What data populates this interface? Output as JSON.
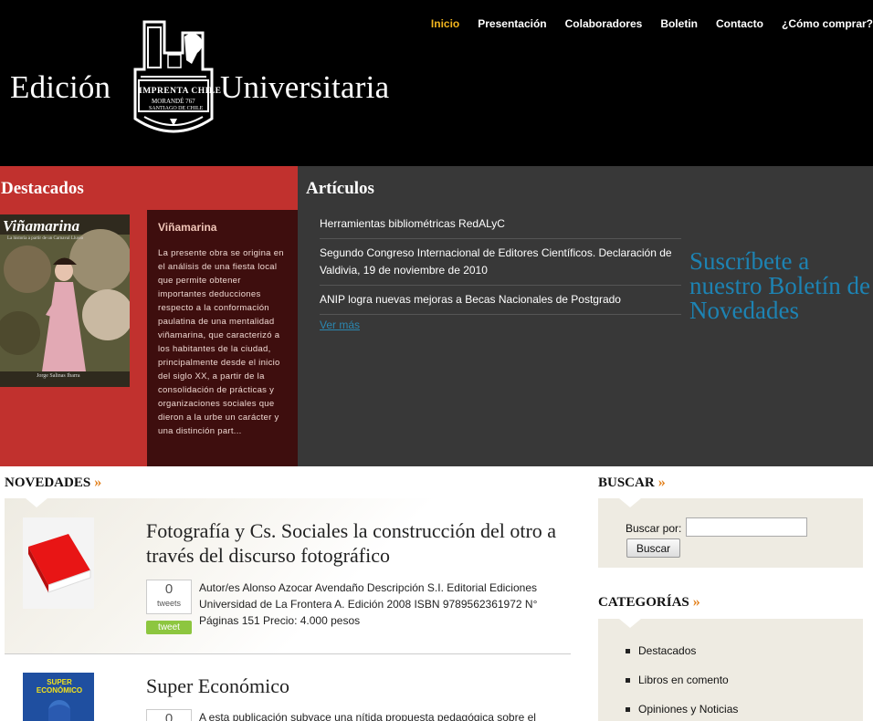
{
  "header": {
    "logo_left": "Edición",
    "logo_right": "Universitaria",
    "nav": [
      {
        "label": "Inicio",
        "active": true
      },
      {
        "label": "Presentación",
        "active": false
      },
      {
        "label": "Colaboradores",
        "active": false
      },
      {
        "label": "Boletin",
        "active": false
      },
      {
        "label": "Contacto",
        "active": false
      },
      {
        "label": "¿Cómo comprar?",
        "active": false
      }
    ],
    "accent_color": "#f2b51e"
  },
  "destacados": {
    "title": "Destacados",
    "book_title": "Viñamarina",
    "excerpt": "La presente obra se origina en el análisis de una fiesta local que permite obtener importantes deducciones respecto a la conformación paulatina de una mentalidad viñamarina, que caracterizó a los habitantes de la ciudad, principalmente desde el inicio del siglo XX, a partir de la consolidación de prácticas y organizaciones sociales que dieron a la urbe un carácter y una distinción part...",
    "cover_title": "Viñamarina",
    "cover_subtitle": "La historia a partir de un Carnaval Lluvio",
    "cover_author": "Jorge Salinas Ibarra",
    "bg_color": "#c1312e"
  },
  "articulos": {
    "title": "Artículos",
    "items": [
      "Herramientas bibliométricas RedALyC",
      "Segundo Congreso Internacional de Editores Científicos. Declaración de Valdivia, 19 de noviembre de 2010",
      "ANIP logra nuevas mejoras a Becas Nacionales de Postgrado"
    ],
    "ver_mas": "Ver más",
    "suscribe": "Suscríbete a nuestro Boletín de Novedades"
  },
  "novedades": {
    "title": "NOVEDADES",
    "books": [
      {
        "title": "Fotografía y Cs. Sociales la construcción del otro a través del discurso fotográfico",
        "count": "0",
        "count_label": "tweets",
        "tweet": "tweet",
        "description": "Autor/es Alonso Azocar Avendaño Descripción S.I. Editorial Ediciones Universidad de La Frontera A. Edición 2008 ISBN 9789562361972 N° Páginas 151 Precio: 4.000 pesos"
      },
      {
        "title": "Super Económico",
        "count": "0",
        "cover_text": "SUPER ECONÓMICO",
        "description": "A esta publicación subyace una nítida propuesta pedagógica sobre el"
      }
    ]
  },
  "sidebar": {
    "search_title": "BUSCAR",
    "search_label": "Buscar por:",
    "search_value": "",
    "search_button": "Buscar",
    "categories_title": "CATEGORÍAS",
    "categories": [
      "Destacados",
      "Libros en comento",
      "Opiniones y Noticias"
    ]
  }
}
